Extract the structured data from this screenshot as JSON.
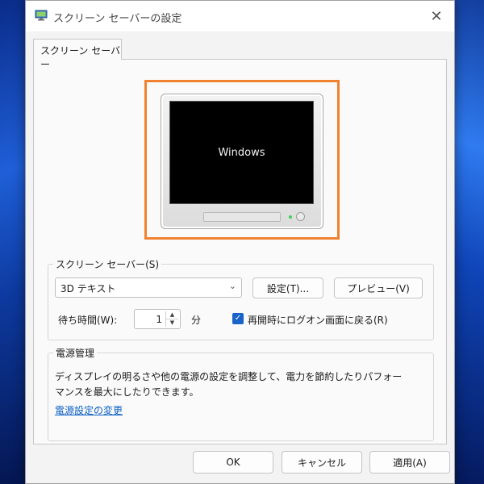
{
  "window": {
    "title": "スクリーン セーバーの設定",
    "close_glyph": "✕"
  },
  "tab": {
    "label": "スクリーン セーバー"
  },
  "preview": {
    "screen_text": "Windows",
    "highlight_color": "#f0822f"
  },
  "screensaver": {
    "group_label": "スクリーン セーバー(S)",
    "selected": "3D テキスト",
    "settings_button": "設定(T)...",
    "preview_button": "プレビュー(V)",
    "wait_label": "待ち時間(W):",
    "wait_value": "1",
    "wait_unit": "分",
    "resume_label": "再開時にログオン画面に戻る(R)",
    "resume_checked": true
  },
  "power": {
    "group_label": "電源管理",
    "description": "ディスプレイの明るさや他の電源の設定を調整して、電力を節約したりパフォーマンスを最大にしたりできます。",
    "link": "電源設定の変更"
  },
  "footer": {
    "ok": "OK",
    "cancel": "キャンセル",
    "apply": "適用(A)"
  },
  "colors": {
    "accent": "#1a63c9",
    "link": "#0a5fc4"
  }
}
